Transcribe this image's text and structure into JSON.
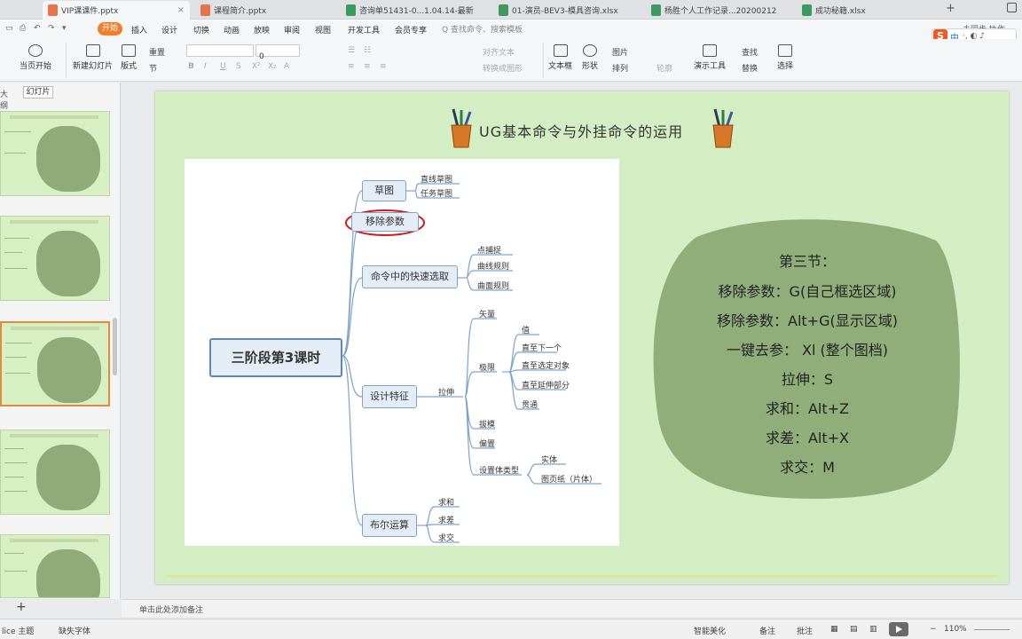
{
  "tabs": [
    {
      "label": "VIP课课件.pptx",
      "type": "ppt",
      "active": true
    },
    {
      "label": "课程简介.pptx",
      "type": "ppt",
      "active": false
    },
    {
      "label": "咨询单51431-0...1.04.14-最新",
      "type": "xls",
      "active": false
    },
    {
      "label": "01-演员-BEV3-模具咨询.xlsx",
      "type": "xls",
      "active": false
    },
    {
      "label": "杨胜个人工作记录...20200212",
      "type": "xls",
      "active": false
    },
    {
      "label": "成功秘籍.xlsx",
      "type": "xls",
      "active": false
    }
  ],
  "menu": {
    "start": "开始",
    "items": [
      "插入",
      "设计",
      "切换",
      "动画",
      "放映",
      "审阅",
      "视图",
      "开发工具",
      "会员专享"
    ],
    "search": "Q 查找命令、搜索模板",
    "top_right": "未同步  协作"
  },
  "sogou": {
    "logo": "S",
    "lang": "中",
    "icons": "·, ◐ ♪"
  },
  "ribbon": {
    "buttons": [
      "当页开始",
      "新建幻灯片",
      "版式",
      "节",
      "重置",
      "文本框",
      "形状",
      "排列",
      "演示工具",
      "选择"
    ],
    "small": [
      "图片",
      "查找",
      "轮廓",
      "替换",
      "对齐文本",
      "转换成图形"
    ],
    "fontsize": "0"
  },
  "left_panel": {
    "tab_outline": "大纲",
    "tab_slides": "幻灯片",
    "add": "+"
  },
  "slide": {
    "title": "UG基本命令与外挂命令的运用",
    "mindmap": {
      "root": "三阶段第3课时",
      "branches": [
        {
          "label": "草图",
          "leaves": [
            "直线草图",
            "任务草图"
          ]
        },
        {
          "label": "移除参数",
          "leaves": []
        },
        {
          "label": "命令中的快速选取",
          "leaves": [
            "点捕捉",
            "曲线规则",
            "曲面规则"
          ]
        },
        {
          "label": "设计特征",
          "sub": "拉伸",
          "leaves": [
            "矢量",
            "极限",
            "值",
            "直至下一个",
            "直至选定对象",
            "直至延伸部分",
            "贯通",
            "拔模",
            "偏置",
            "设置体类型",
            "实体",
            "图页纸（片体）"
          ]
        },
        {
          "label": "布尔运算",
          "leaves": [
            "求和",
            "求差",
            "求交"
          ]
        }
      ]
    },
    "note_lines": [
      "第三节：",
      "移除参数：G(自己框选区域)",
      "移除参数：Alt+G(显示区域)",
      "一键去参：  Xl (整个图档)",
      "拉伸：S",
      "求和：Alt+Z",
      "求差：Alt+X",
      "求交：M"
    ]
  },
  "notes_placeholder": "单击此处添加备注",
  "status": {
    "left": "lice  主题",
    "font": "缺失字体",
    "smart": "智能美化",
    "notes": "备注",
    "annotate": "批注",
    "zoom": "110%"
  }
}
